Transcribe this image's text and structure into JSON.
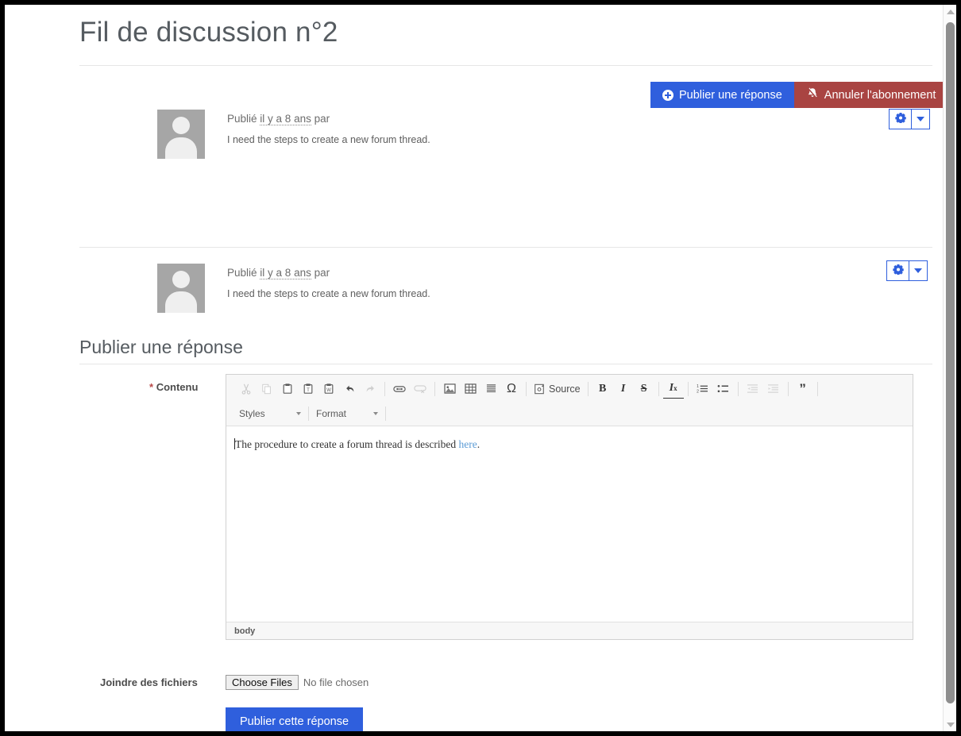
{
  "page": {
    "title": "Fil de discussion n°2"
  },
  "actions": {
    "reply_button": "Publier une réponse",
    "unsubscribe_button": "Annuler l'abonnement",
    "settings_icon": "gear-icon",
    "dropdown_icon": "chevron-down-icon"
  },
  "posts": [
    {
      "meta_prefix": "Publié",
      "meta_time": "il y a 8 ans",
      "meta_suffix": "par",
      "body": "I need the steps to create a new forum thread."
    },
    {
      "meta_prefix": "Publié",
      "meta_time": "il y a 8 ans",
      "meta_suffix": "par",
      "body": "I need the steps to create a new forum thread."
    }
  ],
  "reply_form": {
    "section_title": "Publier une réponse",
    "content_label": "Contenu",
    "required_marker": "*",
    "attach_label": "Joindre des fichiers",
    "file_button": "Choose Files",
    "file_status": "No file chosen",
    "submit_label": "Publier cette réponse"
  },
  "editor": {
    "toolbar_row1": [
      {
        "name": "cut-icon",
        "glyph": "✂",
        "disabled": true
      },
      {
        "name": "copy-icon",
        "glyph": "⎘",
        "disabled": true
      },
      {
        "name": "paste-icon",
        "glyph": "📋",
        "disabled": false
      },
      {
        "name": "paste-text-icon",
        "glyph": "📋",
        "disabled": false
      },
      {
        "name": "paste-word-icon",
        "glyph": "📋",
        "disabled": false
      },
      {
        "name": "undo-icon",
        "glyph": "↰",
        "disabled": false
      },
      {
        "name": "redo-icon",
        "glyph": "↱",
        "disabled": true
      },
      {
        "name": "link-icon",
        "glyph": "🔗",
        "disabled": false
      },
      {
        "name": "unlink-icon",
        "glyph": "🔗",
        "disabled": true
      },
      {
        "name": "image-icon",
        "glyph": "🖼",
        "disabled": false
      },
      {
        "name": "table-icon",
        "glyph": "▦",
        "disabled": false
      },
      {
        "name": "horizontal-rule-icon",
        "glyph": "≡",
        "disabled": false
      },
      {
        "name": "special-character-icon",
        "glyph": "Ω",
        "disabled": false
      },
      {
        "name": "source-button",
        "glyph": "Source",
        "disabled": false
      },
      {
        "name": "bold-icon",
        "glyph": "B",
        "disabled": false
      },
      {
        "name": "italic-icon",
        "glyph": "I",
        "disabled": false
      },
      {
        "name": "strikethrough-icon",
        "glyph": "S",
        "disabled": false
      },
      {
        "name": "remove-format-icon",
        "glyph": "Ix",
        "disabled": false
      },
      {
        "name": "numbered-list-icon",
        "glyph": "1≡",
        "disabled": false
      },
      {
        "name": "bulleted-list-icon",
        "glyph": "•≡",
        "disabled": false
      },
      {
        "name": "decrease-indent-icon",
        "glyph": "⇤",
        "disabled": true
      },
      {
        "name": "increase-indent-icon",
        "glyph": "⇥",
        "disabled": true
      },
      {
        "name": "blockquote-icon",
        "glyph": "❞",
        "disabled": false
      }
    ],
    "styles_label": "Styles",
    "format_label": "Format",
    "source_label": "Source",
    "content_text": "The procedure to create a forum thread is described ",
    "content_link": "here",
    "content_tail": ".",
    "elements_path": "body"
  },
  "colors": {
    "primary": "#2f5fdd",
    "danger": "#a94442",
    "link": "#5b9bd5",
    "required": "#b94a48",
    "title_text": "#555b60"
  }
}
